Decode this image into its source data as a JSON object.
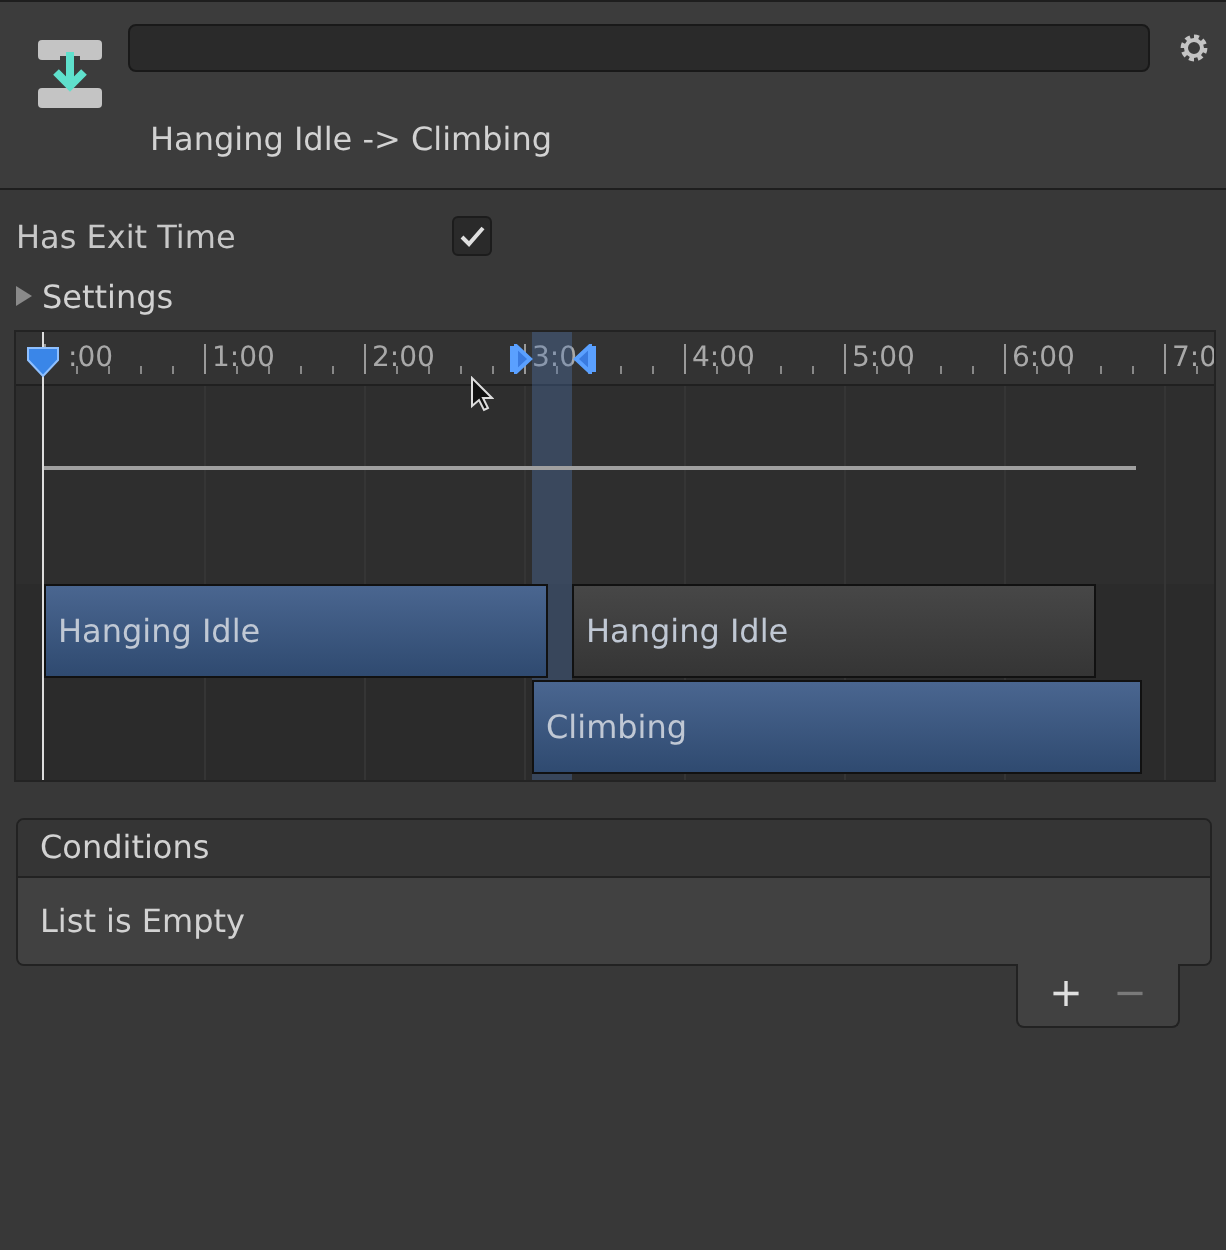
{
  "header": {
    "title": "Hanging Idle -> Climbing"
  },
  "has_exit_time": {
    "label": "Has Exit Time",
    "checked": true
  },
  "settings": {
    "label": "Settings",
    "expanded": false
  },
  "timeline": {
    "ticks": [
      ":00",
      "1:00",
      "2:00",
      "3:0",
      "4:00",
      "5:00",
      "6:00",
      "7:0"
    ],
    "clips": [
      {
        "label": "Hanging Idle",
        "kind": "source"
      },
      {
        "label": "Hanging Idle",
        "kind": "source-loop"
      },
      {
        "label": "Climbing",
        "kind": "destination"
      }
    ]
  },
  "conditions": {
    "title": "Conditions",
    "empty_text": "List is Empty",
    "buttons": [
      {
        "label": "+",
        "disabled": false
      },
      {
        "label": "−",
        "disabled": true
      }
    ]
  }
}
